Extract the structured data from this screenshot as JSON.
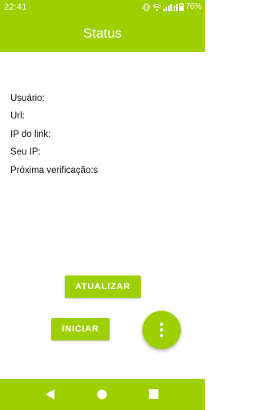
{
  "status_bar": {
    "time": "22:41",
    "battery": "76%",
    "icons": [
      "vibrate-icon",
      "wifi-icon",
      "signal-icon",
      "battery-icon"
    ]
  },
  "app_bar": {
    "title": "Status"
  },
  "fields": {
    "usuario": "Usuário:",
    "url": "Url:",
    "ip_link": "IP do link:",
    "seu_ip": "Seu IP:",
    "proxima": "Próxima verificação:s"
  },
  "buttons": {
    "atualizar": "ATUALIZAR",
    "iniciar": "INICIAR"
  },
  "fab": {
    "icon": "more-vert-icon"
  },
  "nav_bar": {
    "icons": [
      "back-icon",
      "home-icon",
      "recents-icon"
    ]
  },
  "colors": {
    "accent": "#9ecf00",
    "text": "#111111",
    "on_accent": "#ffffff"
  }
}
